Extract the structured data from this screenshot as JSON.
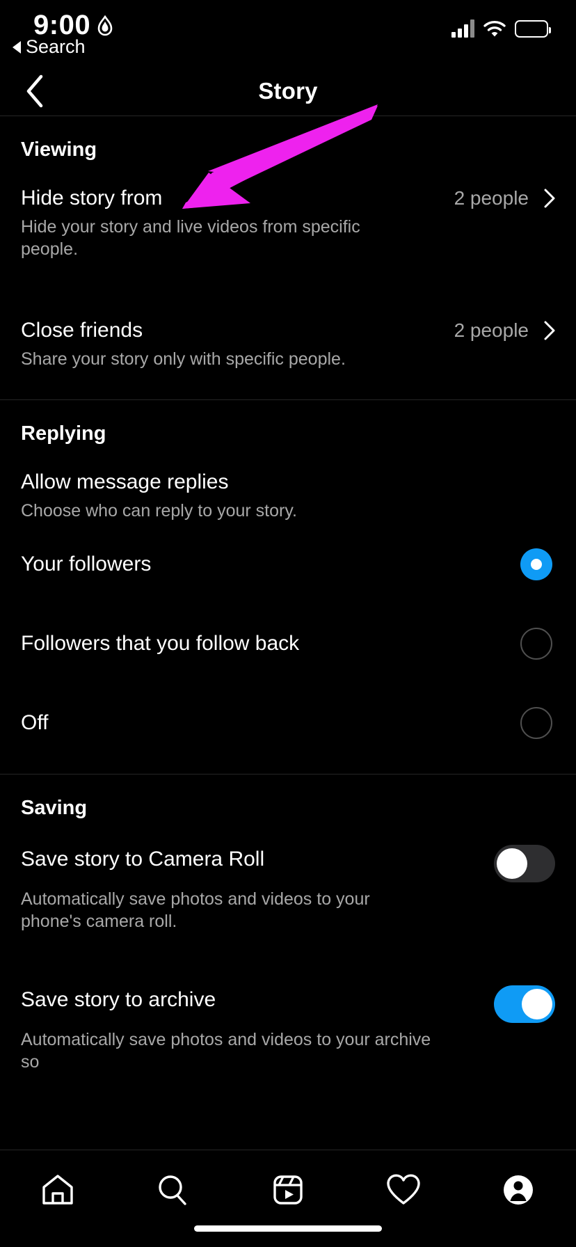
{
  "status_bar": {
    "time": "9:00",
    "location_icon": "location-arrow-icon",
    "cellular_icon": "cellular-bars-icon",
    "wifi_icon": "wifi-icon",
    "battery_icon": "battery-icon"
  },
  "back_to_app": {
    "label": "Search",
    "icon": "back-triangle-icon"
  },
  "header": {
    "title": "Story",
    "back_icon": "chevron-left-icon"
  },
  "annotation": {
    "type": "arrow",
    "color": "#ee22ee",
    "points_to": "Hide story from"
  },
  "sections": [
    {
      "title": "Viewing",
      "rows": [
        {
          "title": "Hide story from",
          "subtitle": "Hide your story and live videos from specific people.",
          "value": "2 people",
          "chevron": "chevron-right-icon"
        },
        {
          "title": "Close friends",
          "subtitle": "Share your story only with specific people.",
          "value": "2 people",
          "chevron": "chevron-right-icon"
        }
      ]
    },
    {
      "title": "Replying",
      "group": {
        "title": "Allow message replies",
        "subtitle": "Choose who can reply to your story."
      },
      "options": [
        {
          "label": "Your followers",
          "selected": true
        },
        {
          "label": "Followers that you follow back",
          "selected": false
        },
        {
          "label": "Off",
          "selected": false
        }
      ]
    },
    {
      "title": "Saving",
      "switches": [
        {
          "title": "Save story to Camera Roll",
          "subtitle": "Automatically save photos and videos to your phone's camera roll.",
          "on": false
        },
        {
          "title": "Save story to archive",
          "subtitle": "Automatically save photos and videos to your archive so",
          "on": true
        }
      ]
    }
  ],
  "tabbar": {
    "items": [
      {
        "icon": "home-icon",
        "name": "tab-home"
      },
      {
        "icon": "search-icon",
        "name": "tab-search"
      },
      {
        "icon": "reels-icon",
        "name": "tab-reels"
      },
      {
        "icon": "heart-icon",
        "name": "tab-activity"
      },
      {
        "icon": "profile-icon",
        "name": "tab-profile"
      }
    ]
  },
  "colors": {
    "accent_blue": "#0f9bf5",
    "annotation_magenta": "#ee22ee",
    "secondary_text": "#a8a8a8",
    "divider": "#262626",
    "toggle_off_track": "#2e2e30"
  }
}
